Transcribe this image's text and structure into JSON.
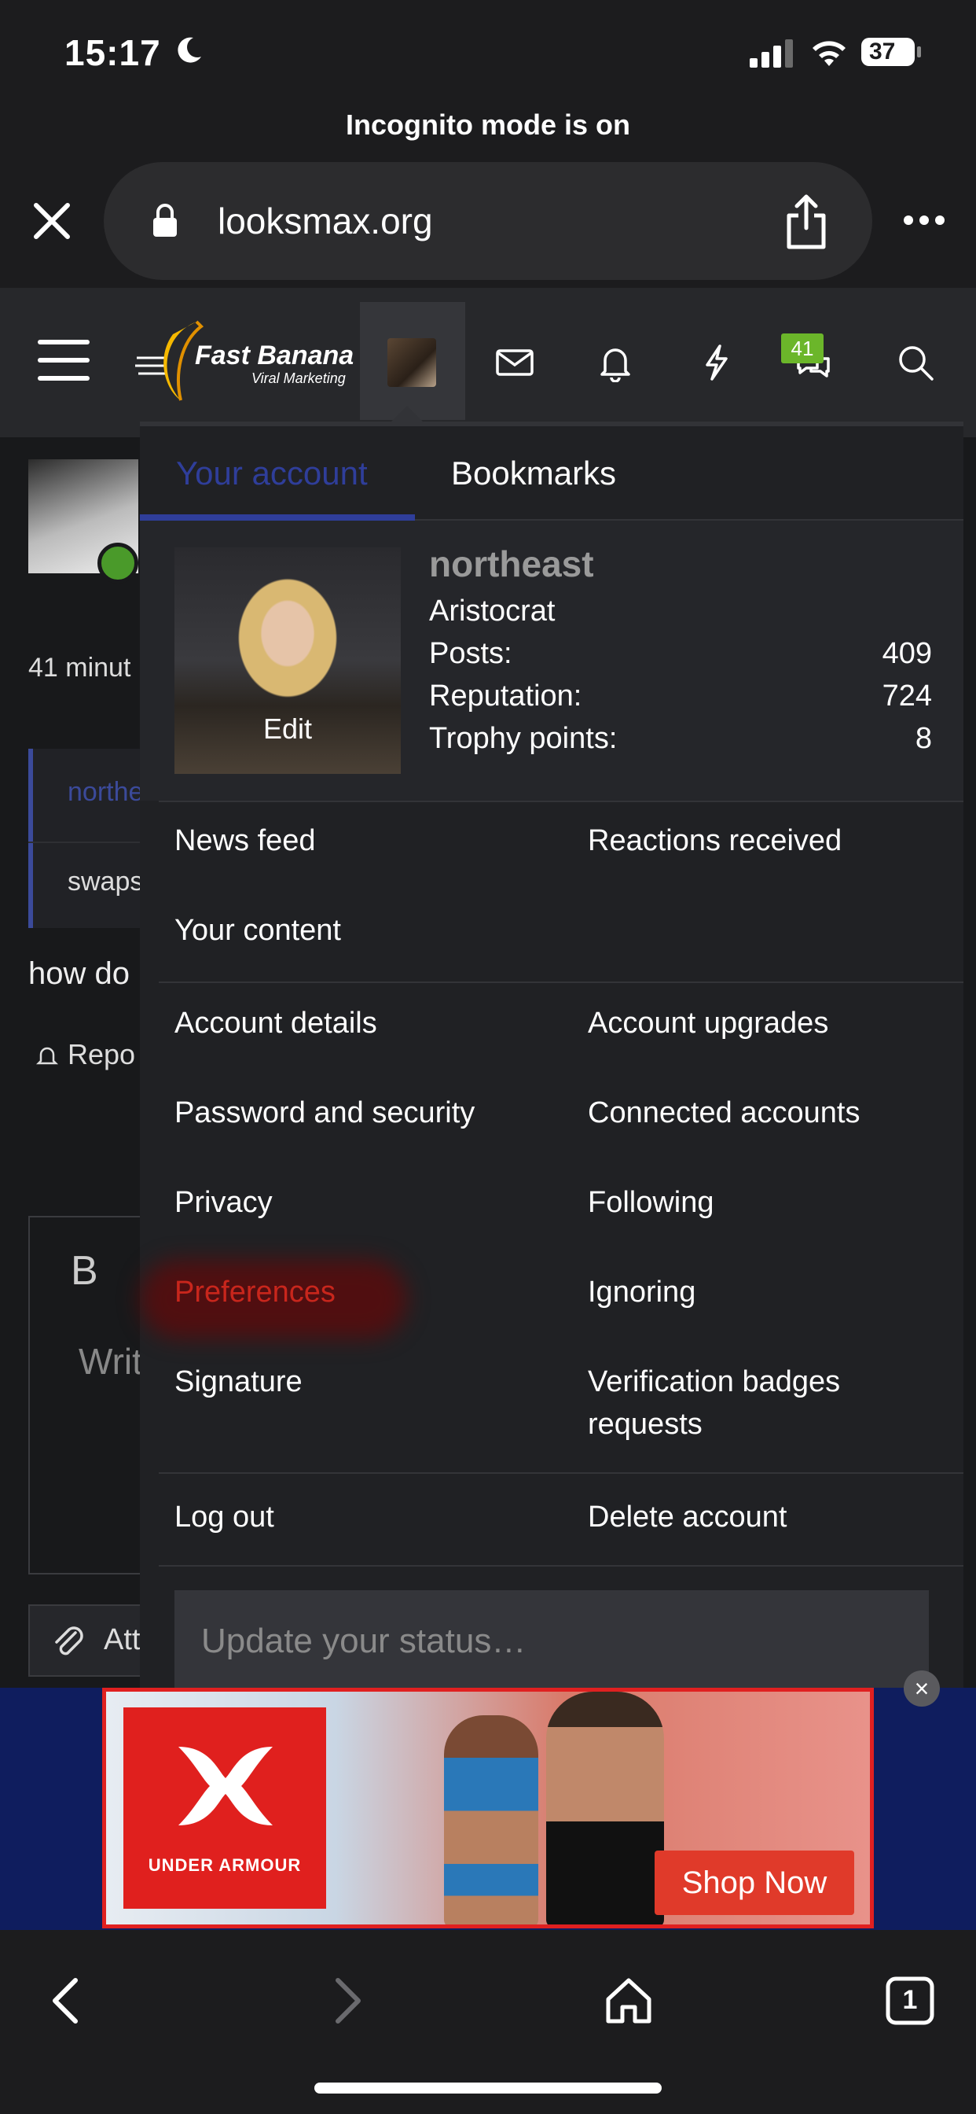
{
  "status_bar": {
    "time": "15:17",
    "battery": "37"
  },
  "browser": {
    "incognito_label": "Incognito mode is on",
    "url": "looksmax.org"
  },
  "site": {
    "logo_text": "Fast Banana",
    "logo_subtext": "Viral Marketing",
    "conversations_badge": "41"
  },
  "background": {
    "time_snippet": "41 minut",
    "quote_author": "northe",
    "quote_text": "swaps",
    "post_text": "how do",
    "report_label": "Repo",
    "editor_bold": "B",
    "editor_placeholder": "Writ",
    "attach_label": "Att"
  },
  "account_menu": {
    "tabs": [
      {
        "label": "Your account"
      },
      {
        "label": "Bookmarks"
      }
    ],
    "profile": {
      "photo_edit_label": "Edit",
      "username": "northeast",
      "user_title": "Aristocrat",
      "stats": [
        {
          "label": "Posts:",
          "value": "409"
        },
        {
          "label": "Reputation:",
          "value": "724"
        },
        {
          "label": "Trophy points:",
          "value": "8"
        }
      ]
    },
    "links": {
      "news_feed": "News feed",
      "reactions_received": "Reactions received",
      "your_content": "Your content",
      "account_details": "Account details",
      "account_upgrades": "Account upgrades",
      "password_security": "Password and security",
      "connected_accounts": "Connected accounts",
      "privacy": "Privacy",
      "following": "Following",
      "preferences": "Preferences",
      "ignoring": "Ignoring",
      "signature": "Signature",
      "verification_badges": "Verification badges requests",
      "log_out": "Log out",
      "delete_account": "Delete account"
    },
    "status_placeholder": "Update your status…"
  },
  "ad": {
    "brand": "UNDER ARMOUR",
    "cta": "Shop Now",
    "close": "×"
  },
  "toolbar": {
    "tabs_count": "1"
  },
  "colors": {
    "accent_blue": "#2f3e9a",
    "highlight_red": "#c8261c",
    "badge_green": "#6bb62a",
    "ad_red": "#e0201e"
  }
}
